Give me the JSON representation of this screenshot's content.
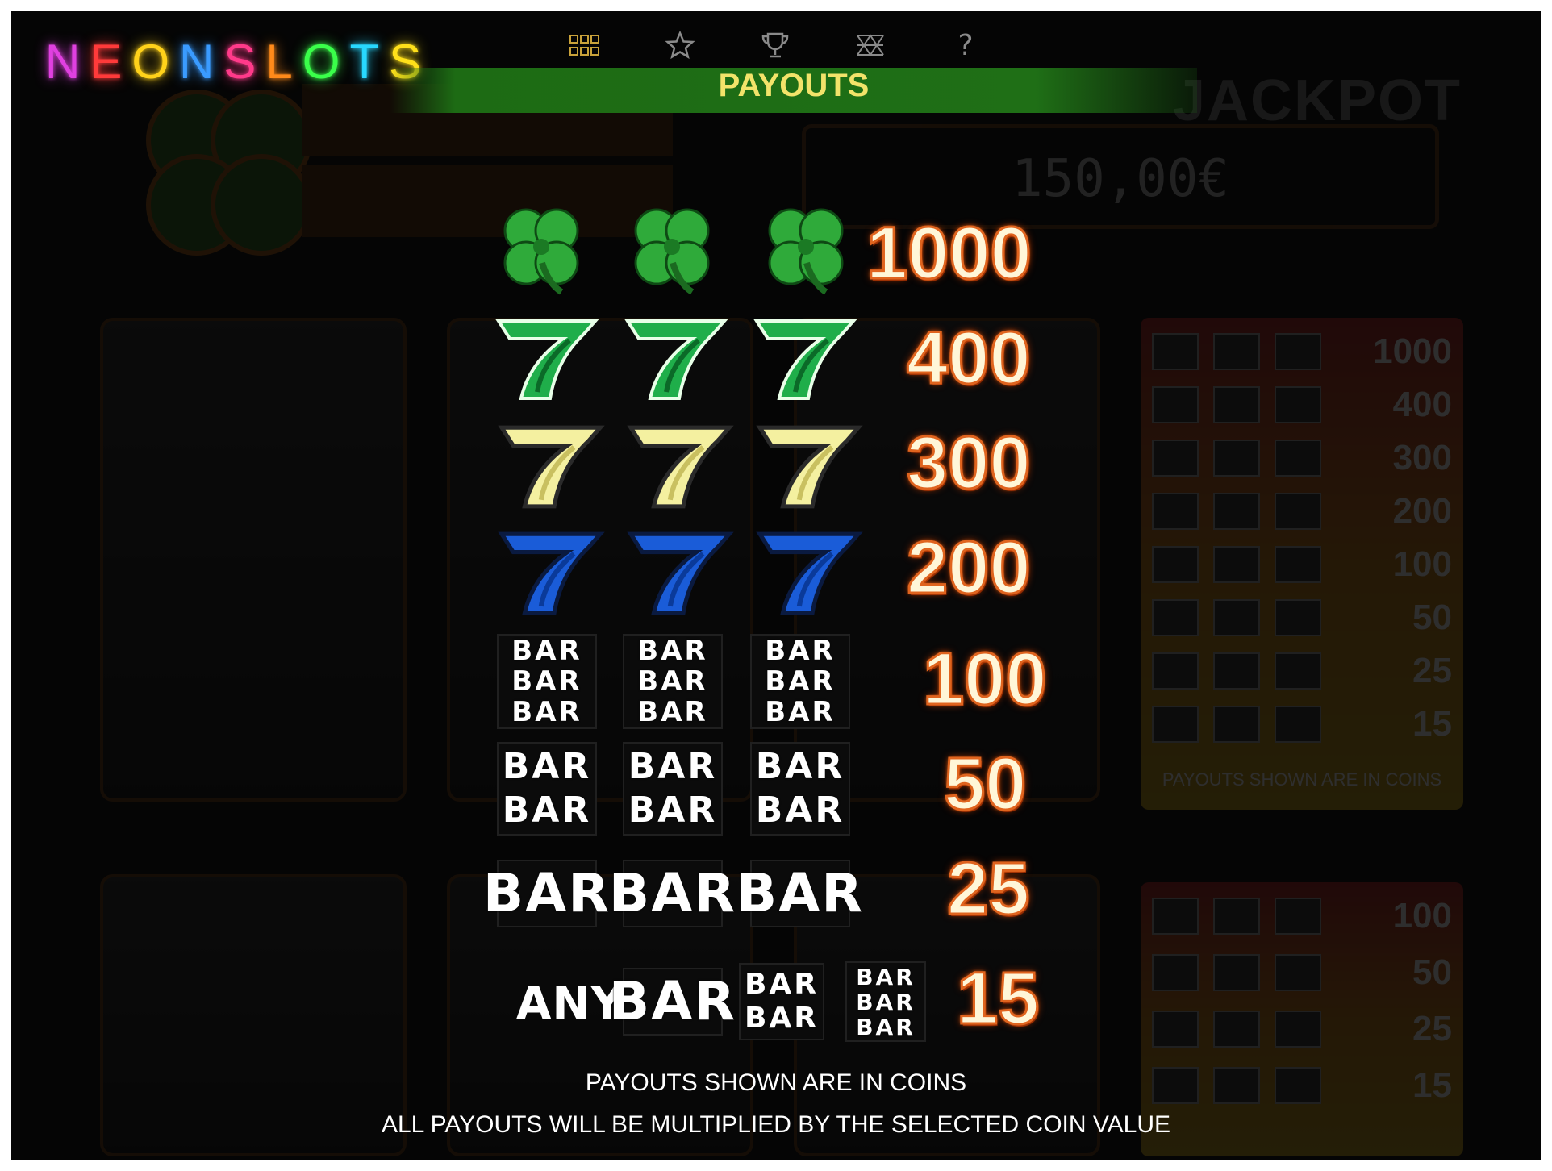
{
  "logo": {
    "letters": [
      "N",
      "E",
      "O",
      "N",
      "S",
      "L",
      "O",
      "T",
      "S"
    ],
    "colors": [
      "#e040e0",
      "#ff3a3a",
      "#ffd21a",
      "#3a9bff",
      "#ff3a8a",
      "#ff8a1a",
      "#3aff4a",
      "#28d8ff",
      "#ffe01a"
    ]
  },
  "nav": [
    {
      "name": "menu-grid",
      "icon": "grid-icon"
    },
    {
      "name": "favorites",
      "icon": "star-icon"
    },
    {
      "name": "trophies",
      "icon": "trophy-icon"
    },
    {
      "name": "settings",
      "icon": "pattern-icon"
    },
    {
      "name": "help",
      "icon": "question-icon",
      "label": "?"
    }
  ],
  "title": "PAYOUTS",
  "background": {
    "jackpot_label": "JACKPOT",
    "jackpot_value": "150,00€",
    "mini_payouts": [
      "1000",
      "400",
      "300",
      "200",
      "100",
      "50",
      "25",
      "15"
    ],
    "mini_payouts_lower": [
      "100",
      "50",
      "25",
      "15"
    ],
    "mini_note": "PAYOUTS SHOWN ARE IN COINS"
  },
  "paytable": [
    {
      "symbol": "clover",
      "count": 3,
      "payout": "1000"
    },
    {
      "symbol": "green-seven",
      "count": 3,
      "payout": "400"
    },
    {
      "symbol": "yellow-seven",
      "count": 3,
      "payout": "300"
    },
    {
      "symbol": "blue-seven",
      "count": 3,
      "payout": "200"
    },
    {
      "symbol": "triple-bar",
      "count": 3,
      "payout": "100"
    },
    {
      "symbol": "double-bar",
      "count": 3,
      "payout": "50"
    },
    {
      "symbol": "single-bar",
      "count": 3,
      "payout": "25"
    },
    {
      "symbol": "any-bar",
      "any_label": "ANY",
      "payout": "15"
    }
  ],
  "bar_word": "BAR",
  "notes": {
    "line1": "PAYOUTS SHOWN ARE IN COINS",
    "line2": "ALL PAYOUTS WILL BE MULTIPLIED BY THE SELECTED COIN VALUE"
  },
  "colors": {
    "title_bar": "#1f6f16",
    "title_text": "#f2e36a",
    "payout_glow": "#e0641e",
    "clover": "#2faa3a",
    "green_seven": "#1fae4a",
    "yellow_seven": "#f4f0a0",
    "blue_seven": "#1a5cd8"
  }
}
